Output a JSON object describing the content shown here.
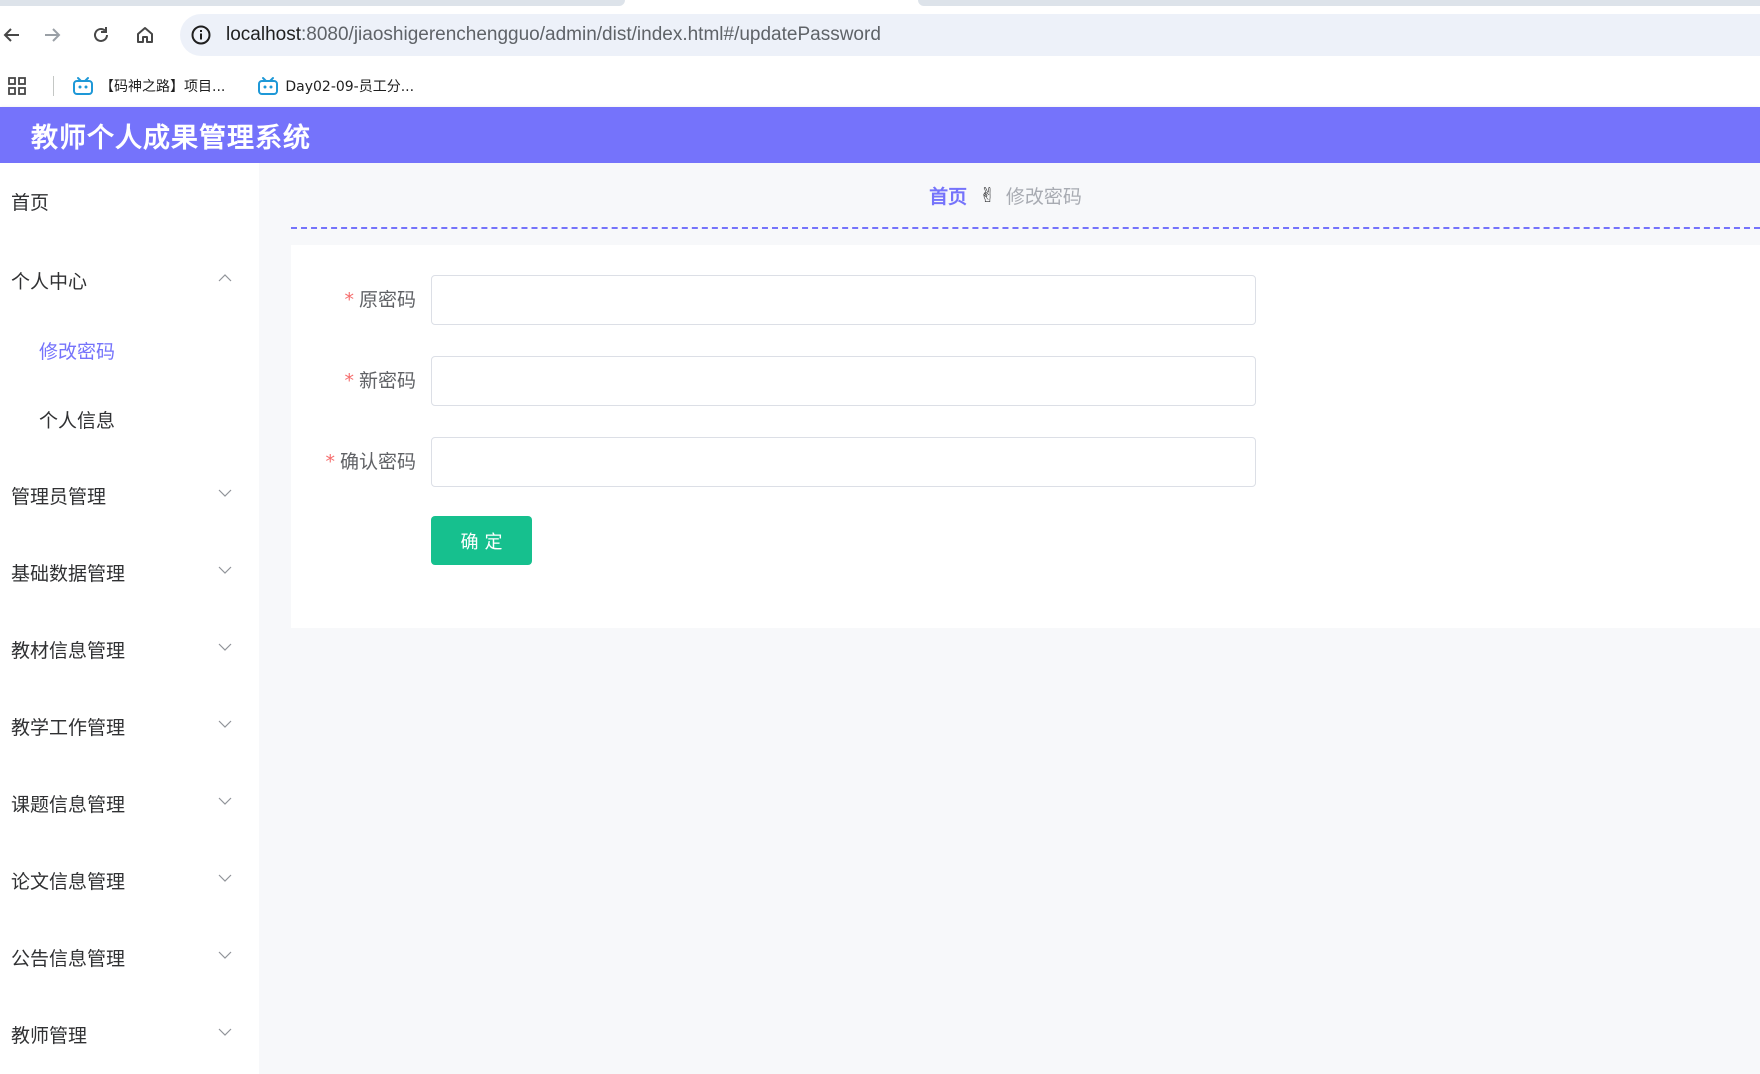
{
  "browser": {
    "url_host": "localhost",
    "url_path": ":8080/jiaoshigerenchengguo/admin/dist/index.html#/updatePassword",
    "icons": [
      "back-arrow-icon",
      "forward-arrow-icon",
      "reload-icon",
      "home-icon",
      "site-info-icon"
    ],
    "bookmarks": [
      {
        "label": "【码神之路】项目...",
        "icon": "bilibili-icon"
      },
      {
        "label": "Day02-09-员工分...",
        "icon": "bilibili-icon"
      }
    ]
  },
  "app": {
    "title": "教师个人成果管理系统",
    "accent_color": "#7573fb",
    "button_color": "#16c08e"
  },
  "sidebar": {
    "items": [
      {
        "label": "首页"
      },
      {
        "label": "个人中心",
        "expanded": true
      },
      {
        "label": "修改密码",
        "sub": true,
        "active": true
      },
      {
        "label": "个人信息",
        "sub": true
      },
      {
        "label": "管理员管理"
      },
      {
        "label": "基础数据管理"
      },
      {
        "label": "教材信息管理"
      },
      {
        "label": "教学工作管理"
      },
      {
        "label": "课题信息管理"
      },
      {
        "label": "论文信息管理"
      },
      {
        "label": "公告信息管理"
      },
      {
        "label": "教师管理"
      }
    ]
  },
  "breadcrumb": {
    "home": "首页",
    "separator": "✌",
    "current": "修改密码"
  },
  "form": {
    "fields": [
      {
        "label": "原密码",
        "required": "*",
        "value": ""
      },
      {
        "label": "新密码",
        "required": "*",
        "value": ""
      },
      {
        "label": "确认密码",
        "required": "*",
        "value": ""
      }
    ],
    "submit_label": "确定"
  }
}
